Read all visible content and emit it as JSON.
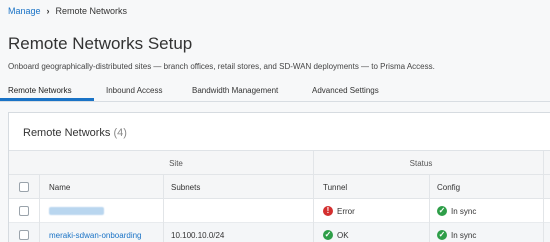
{
  "breadcrumb": {
    "parent": "Manage",
    "current": "Remote Networks"
  },
  "page": {
    "title": "Remote Networks Setup",
    "subtitle": "Onboard geographically-distributed sites — branch offices, retail stores, and SD-WAN deployments — to Prisma Access."
  },
  "tabs": [
    "Remote Networks",
    "Inbound Access",
    "Bandwidth Management",
    "Advanced Settings"
  ],
  "panel": {
    "title": "Remote Networks",
    "count": "(4)"
  },
  "table": {
    "group_site": "Site",
    "group_status": "Status",
    "col_name": "Name",
    "col_subnets": "Subnets",
    "col_tunnel": "Tunnel",
    "col_config": "Config",
    "rows": [
      {
        "name": "",
        "subnets": "",
        "tunnel": "Error",
        "config": "In sync"
      },
      {
        "name": "meraki-sdwan-onboarding",
        "subnets": "10.100.10.0/24",
        "tunnel": "OK",
        "config": "In sync"
      }
    ]
  },
  "colors": {
    "accent": "#1a73c6",
    "error": "#d32f2f",
    "ok": "#2e9e48"
  }
}
